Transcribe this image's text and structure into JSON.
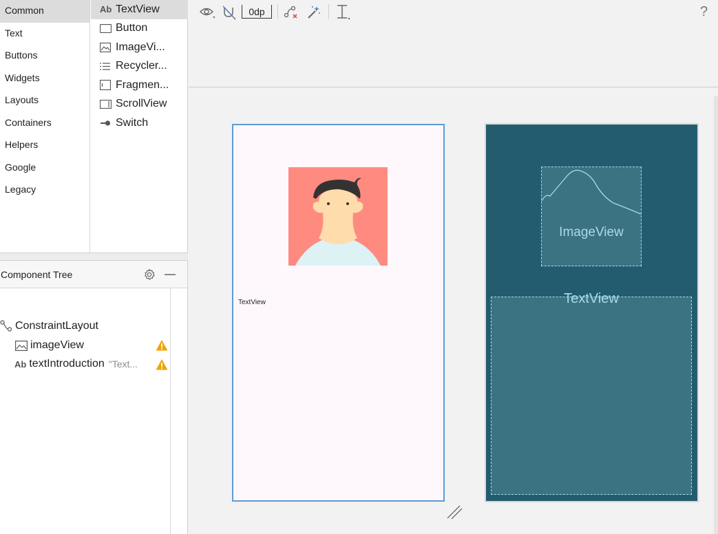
{
  "palette": {
    "categories": [
      "Common",
      "Text",
      "Buttons",
      "Widgets",
      "Layouts",
      "Containers",
      "Helpers",
      "Google",
      "Legacy"
    ],
    "widgets": [
      {
        "icon": "text-view-icon",
        "label": "TextView",
        "glyph": "Ab"
      },
      {
        "icon": "button-icon",
        "label": "Button"
      },
      {
        "icon": "image-view-icon",
        "label": "ImageVi..."
      },
      {
        "icon": "recycler-view-icon",
        "label": "Recycler..."
      },
      {
        "icon": "fragment-icon",
        "label": "Fragmen..."
      },
      {
        "icon": "scroll-view-icon",
        "label": "ScrollView"
      },
      {
        "icon": "switch-icon",
        "label": "Switch"
      }
    ]
  },
  "component_tree": {
    "title": "Component Tree",
    "nodes": [
      {
        "icon": "constraint-layout-icon",
        "label": "ConstraintLayout",
        "hint": ""
      },
      {
        "icon": "image-view-icon",
        "label": "imageView",
        "hint": "",
        "warning": true
      },
      {
        "icon": "text-view-icon",
        "glyph": "Ab",
        "label": "textIntroduction",
        "hint": "\"Text...",
        "warning": true
      }
    ]
  },
  "toolbar": {
    "default_margin": "0dp",
    "help": "?"
  },
  "design": {
    "textview_text": "TextView"
  },
  "blueprint": {
    "image_label": "ImageView",
    "textview_label": "TextView"
  },
  "colors": {
    "selection": "#dcdcdc",
    "design_border": "#5b9bd5",
    "blueprint_bg": "#245c6f",
    "blueprint_fill": "#3b7383",
    "blueprint_line": "#a9dbe8",
    "warning": "#f0a30a",
    "avatar_bg": "#ff8a80"
  }
}
